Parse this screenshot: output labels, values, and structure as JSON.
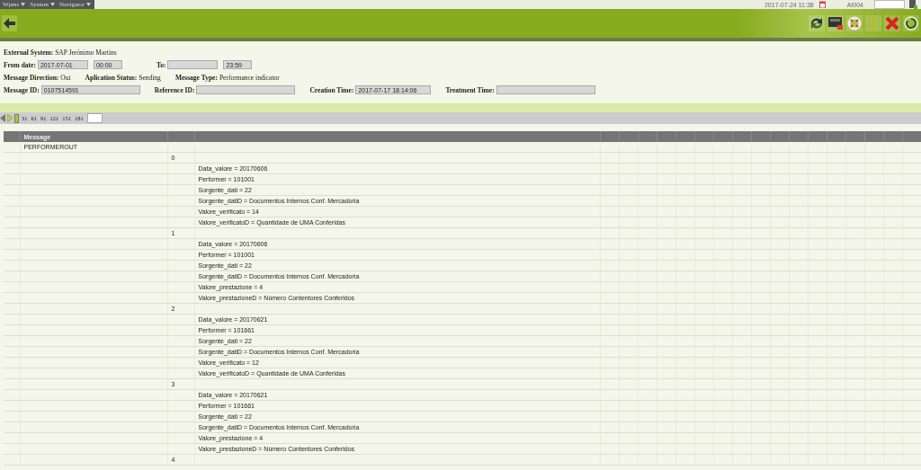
{
  "menu": [
    {
      "label": "Wpms"
    },
    {
      "label": "System"
    },
    {
      "label": "Navigator"
    }
  ],
  "top_right": {
    "datetime": "2017-07-24  11:38",
    "user": "AI004"
  },
  "form": {
    "rows": [
      [
        {
          "kind": "text",
          "label": "External System:",
          "value": "SAP Jerónimo Martins"
        }
      ],
      [
        {
          "kind": "field",
          "label": "From date:",
          "value": "2017-07-01",
          "extra": "00:00"
        },
        {
          "kind": "field",
          "label": "To:",
          "extra": "23:59"
        }
      ],
      [
        {
          "kind": "text",
          "label": "Message Direction:",
          "value": "Out"
        },
        {
          "kind": "text",
          "label": "Aplication Status:",
          "value": "Sending"
        },
        {
          "kind": "text",
          "label": "Message Type:",
          "value": "Performance indicator"
        }
      ],
      [
        {
          "kind": "field",
          "label": "Message ID:",
          "value": "0107514591"
        },
        {
          "kind": "field",
          "label": "Reference ID:"
        },
        {
          "kind": "field",
          "label": "Creation Time:",
          "value": "2017-07-17  18:14:06"
        },
        {
          "kind": "field",
          "label": "Treatment Time:"
        }
      ]
    ]
  },
  "pager": {
    "pages": [
      {
        "label": "31"
      },
      {
        "label": "61"
      },
      {
        "label": "91"
      },
      {
        "label": "121"
      },
      {
        "label": "151"
      },
      {
        "label": "181"
      }
    ]
  },
  "table": {
    "columns": [
      {
        "label": "Message"
      }
    ],
    "rows": [
      {
        "text": "PERFORMEROUT",
        "children": [
          {
            "text": "0",
            "children": [
              {
                "text": "Data_valore = 20170606"
              },
              {
                "text": "Performer = 101001"
              },
              {
                "text": "Sorgente_dati = 22"
              },
              {
                "text": "Sorgente_datiD = Documentos Internos Conf. Mercadoria"
              },
              {
                "text": "Valore_verificato = 14"
              },
              {
                "text": "Valore_verificatoD = Quantidade de UMA Conferidas"
              }
            ]
          },
          {
            "text": "1",
            "children": [
              {
                "text": "Data_valore = 20170606"
              },
              {
                "text": "Performer = 101001"
              },
              {
                "text": "Sorgente_dati = 22"
              },
              {
                "text": "Sorgente_datiD = Documentos Internos Conf. Mercadoria"
              },
              {
                "text": "Valore_prestazione = 4"
              },
              {
                "text": "Valore_prestazioneD = Número Contentores Conferidos"
              }
            ]
          },
          {
            "text": "2",
            "children": [
              {
                "text": "Data_valore = 20170621"
              },
              {
                "text": "Performer = 101661"
              },
              {
                "text": "Sorgente_dati = 22"
              },
              {
                "text": "Sorgente_datiD = Documentos Internos Conf. Mercadoria"
              },
              {
                "text": "Valore_verificato = 12"
              },
              {
                "text": "Valore_verificatoD = Quantidade de UMA Conferidas"
              }
            ]
          },
          {
            "text": "3",
            "children": [
              {
                "text": "Data_valore = 20170621"
              },
              {
                "text": "Performer = 101661"
              },
              {
                "text": "Sorgente_dati = 22"
              },
              {
                "text": "Sorgente_datiD = Documentos Internos Conf. Mercadoria"
              },
              {
                "text": "Valore_prestazione = 4"
              },
              {
                "text": "Valore_prestazioneD = Número Contentores Conferidos"
              }
            ]
          },
          {
            "text": "4"
          }
        ]
      }
    ]
  }
}
